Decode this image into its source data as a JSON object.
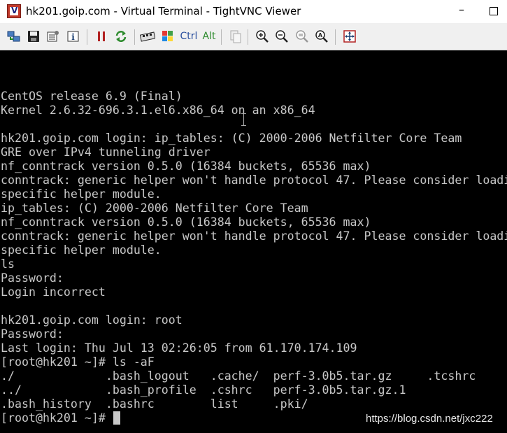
{
  "window": {
    "title": "hk201.goip.com - Virtual Terminal - TightVNC Viewer",
    "min_glyph": "–"
  },
  "toolbar": {
    "items": [
      {
        "name": "new-connection-icon"
      },
      {
        "name": "save-icon"
      },
      {
        "name": "options-icon"
      },
      {
        "name": "connection-info-icon"
      },
      {
        "name": "pause-icon"
      },
      {
        "name": "refresh-icon"
      },
      {
        "name": "ctrl-alt-del-icon"
      },
      {
        "name": "ctrl-esc-icon"
      },
      {
        "name": "zoom-in-icon"
      },
      {
        "name": "zoom-out-icon"
      },
      {
        "name": "zoom-100-icon"
      },
      {
        "name": "zoom-auto-icon"
      },
      {
        "name": "fullscreen-icon"
      }
    ],
    "ctrl_label": "Ctrl",
    "alt_label": "Alt"
  },
  "terminal": {
    "lines": [
      "CentOS release 6.9 (Final)",
      "Kernel 2.6.32-696.3.1.el6.x86_64 on an x86_64",
      "",
      "hk201.goip.com login: ip_tables: (C) 2000-2006 Netfilter Core Team",
      "GRE over IPv4 tunneling driver",
      "nf_conntrack version 0.5.0 (16384 buckets, 65536 max)",
      "conntrack: generic helper won't handle protocol 47. Please consider loadi",
      "specific helper module.",
      "ip_tables: (C) 2000-2006 Netfilter Core Team",
      "nf_conntrack version 0.5.0 (16384 buckets, 65536 max)",
      "conntrack: generic helper won't handle protocol 47. Please consider loadi",
      "specific helper module.",
      "ls",
      "Password:",
      "Login incorrect",
      "",
      "hk201.goip.com login: root",
      "Password:",
      "Last login: Thu Jul 13 02:26:05 from 61.170.174.109",
      "[root@hk201 ~]# ls -aF",
      "./             .bash_logout   .cache/  perf-3.0b5.tar.gz     .tcshrc",
      "../            .bash_profile  .cshrc   perf-3.0b5.tar.gz.1",
      ".bash_history  .bashrc        list     .pki/",
      "[root@hk201 ~]# "
    ]
  },
  "watermark": "https://blog.csdn.net/jxc222"
}
